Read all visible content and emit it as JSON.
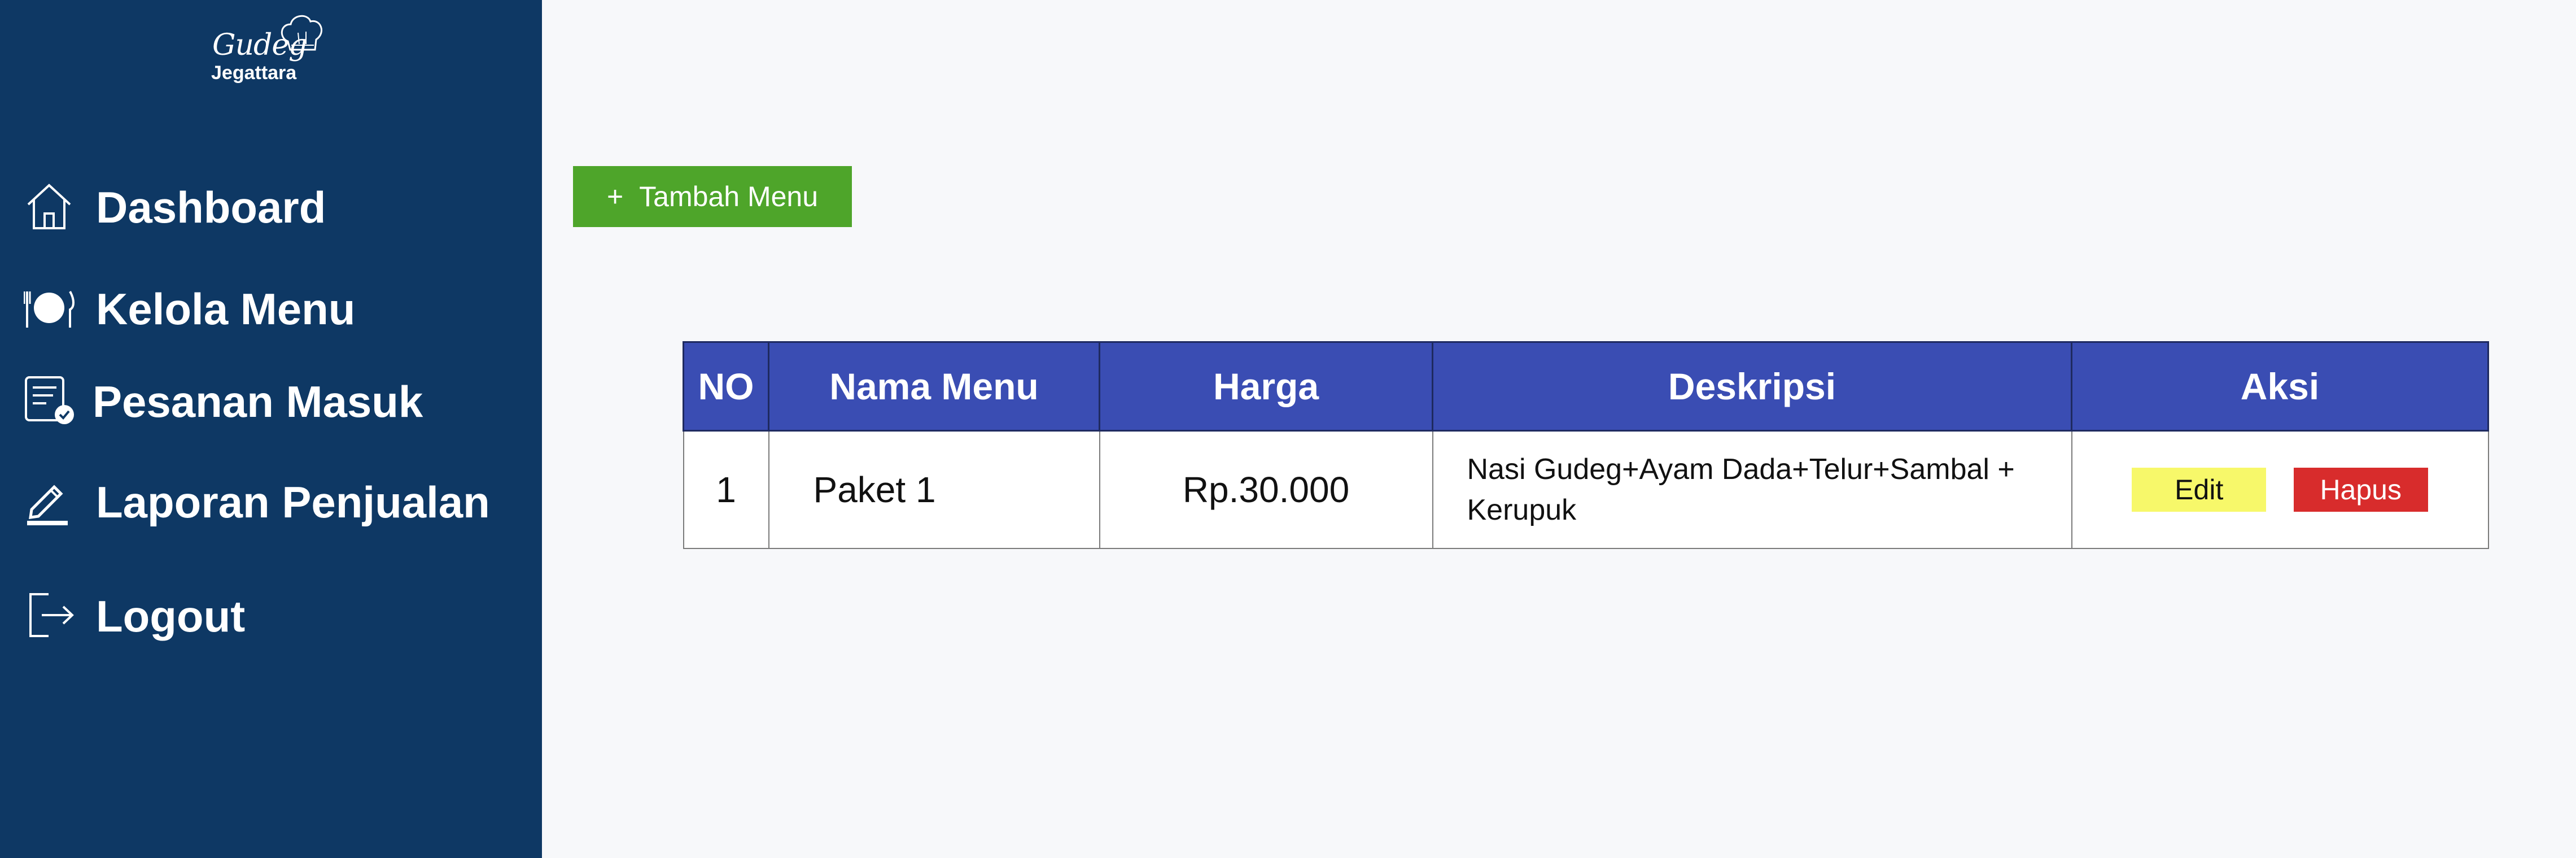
{
  "logo": {
    "script_text": "Gudeg",
    "word_text": "Jegattara"
  },
  "sidebar": {
    "items": [
      {
        "label": "Dashboard",
        "icon": "home-icon"
      },
      {
        "label": "Kelola Menu",
        "icon": "plate-cutlery-icon"
      },
      {
        "label": "Pesanan Masuk",
        "icon": "order-checklist-icon"
      },
      {
        "label": "Laporan Penjualan",
        "icon": "pencil-icon"
      },
      {
        "label": "Logout",
        "icon": "logout-icon"
      }
    ]
  },
  "main": {
    "add_button": {
      "plus": "+",
      "label": "Tambah Menu"
    },
    "table": {
      "headers": [
        "NO",
        "Nama Menu",
        "Harga",
        "Deskripsi",
        "Aksi"
      ],
      "rows": [
        {
          "no": "1",
          "name": "Paket 1",
          "price": "Rp.30.000",
          "description": "Nasi Gudeg+Ayam Dada+Telur+Sambal + Kerupuk",
          "edit_label": "Edit",
          "delete_label": "Hapus"
        }
      ]
    }
  },
  "colors": {
    "sidebar_bg": "#0e3864",
    "add_button": "#4ea52a",
    "table_header": "#3a4db3",
    "edit_button": "#f7f86a",
    "delete_button": "#d82c2c"
  }
}
